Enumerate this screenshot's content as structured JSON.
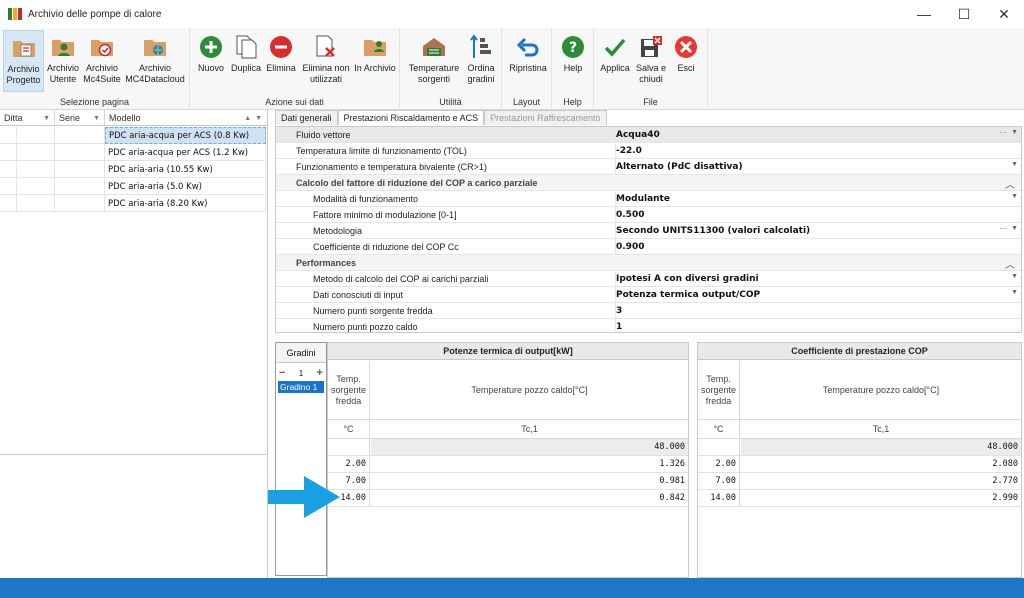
{
  "window": {
    "title": "Archivio delle pompe di calore",
    "minimize": "—",
    "maximize": "☐",
    "close": "✕"
  },
  "ribbon": {
    "groups": [
      {
        "label": "Selezione pagina"
      },
      {
        "label": "Azione sui dati"
      },
      {
        "label": "Utilità"
      },
      {
        "label": "Layout"
      },
      {
        "label": "Help"
      },
      {
        "label": "File"
      }
    ],
    "buttons": {
      "archivio_progetto": "Archivio\nProgetto",
      "archivio_utente": "Archivio\nUtente",
      "archivio_mc4suite": "Archivio\nMc4Suite",
      "archivio_mc4datacloud": "Archivio\nMC4Datacloud",
      "nuovo": "Nuovo",
      "duplica": "Duplica",
      "elimina": "Elimina",
      "elimina_non_utilizzati": "Elimina non\nutilizzati",
      "in_archivio": "In Archivio",
      "temperature_sorgenti": "Temperature\nsorgenti",
      "ordina_gradini": "Ordina\ngradini",
      "ripristina": "Ripristina",
      "help": "Help",
      "applica": "Applica",
      "salva_chiudi": "Salva e\nchiudi",
      "esci": "Esci"
    }
  },
  "left_grid": {
    "columns": [
      "Ditta",
      "Serie",
      "Modello"
    ],
    "rows": [
      {
        "ditta": "",
        "serie": "",
        "modello": "PDC aria-acqua per ACS (0.8 Kw)"
      },
      {
        "ditta": "",
        "serie": "",
        "modello": "PDC aria-acqua per ACS (1.2 Kw)"
      },
      {
        "ditta": "",
        "serie": "",
        "modello": "PDC aria-aria (10.55 Kw)"
      },
      {
        "ditta": "",
        "serie": "",
        "modello": "PDC aria-aria (5.0 Kw)"
      },
      {
        "ditta": "",
        "serie": "",
        "modello": "PDC aria-aria (8.20 Kw)"
      }
    ]
  },
  "tabs": [
    "Dati generali",
    "Prestazioni Riscaldamento e ACS",
    "Prestazioni Raffrescamento"
  ],
  "properties": {
    "fluido_vettore": {
      "name": "Fluido vettore",
      "value": "Acqua40"
    },
    "tol": {
      "name": "Temperatura limite di funzionamento (TOL)",
      "value": "-22.0"
    },
    "funzionamento": {
      "name": "Funzionamento e temperatura bivalente (CR>1)",
      "value": "Alternato (PdC disattiva)"
    },
    "cat_riduzione": "Calcolo del fattore di riduzione del COP a carico parziale",
    "modalita": {
      "name": "Modalità di funzionamento",
      "value": "Modulante"
    },
    "fattore_minimo": {
      "name": "Fattore minimo di modulazione [0-1]",
      "value": "0.500"
    },
    "metodologia": {
      "name": "Metodologia",
      "value": "Secondo UNITS11300 (valori calcolati)"
    },
    "coefficiente": {
      "name": "Coefficiente di riduzione del COP Cc",
      "value": "0.900"
    },
    "cat_performances": "Performances",
    "metodo": {
      "name": "Metodo di calcolo del COP ai carichi parziali",
      "value": "Ipotesi A con diversi gradini"
    },
    "dati_input": {
      "name": "Dati conosciuti di input",
      "value": "Potenza termica output/COP"
    },
    "punti_fredda": {
      "name": "Numero punti sorgente fredda",
      "value": "3"
    },
    "punti_caldo": {
      "name": "Numero punti pozzo caldo",
      "value": "1"
    }
  },
  "gradini": {
    "title": "Gradini",
    "count": "1",
    "minus": "−",
    "plus": "+",
    "items": [
      "Gradino 1"
    ]
  },
  "potenza_table": {
    "title": "Potenze termica di output[kW]",
    "col1_header": "Temp.\nsorgente\nfredda",
    "col2_header": "Temperature pozzo caldo[°C]",
    "unit1": "°C",
    "unit2": "Tc,1",
    "header_value": "48.000",
    "rows": [
      {
        "t": "2.00",
        "v": "1.326"
      },
      {
        "t": "7.00",
        "v": "0.981"
      },
      {
        "t": "14.00",
        "v": "0.842"
      }
    ]
  },
  "cop_table": {
    "title": "Coefficiente di prestazione COP",
    "col1_header": "Temp.\nsorgente\nfredda",
    "col2_header": "Temperature pozzo caldo[°C]",
    "unit1": "°C",
    "unit2": "Tc,1",
    "header_value": "48.000",
    "rows": [
      {
        "t": "2.00",
        "v": "2.080"
      },
      {
        "t": "7.00",
        "v": "2.770"
      },
      {
        "t": "14.00",
        "v": "2.990"
      }
    ]
  },
  "colors": {
    "accent": "#1e78c8",
    "selection": "#cfe2f4",
    "arrow": "#1aa0e0"
  }
}
